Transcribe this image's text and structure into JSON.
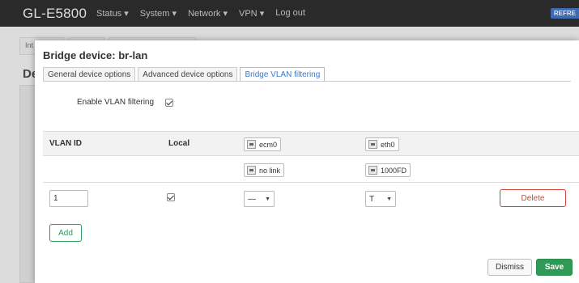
{
  "header": {
    "brand": "GL-E5800",
    "nav": [
      "Status",
      "System",
      "Network",
      "VPN",
      "Log out"
    ],
    "refresh_badge": "REFRE"
  },
  "background": {
    "tabs": [
      "Int",
      "",
      ""
    ],
    "title": "De"
  },
  "modal": {
    "title": "Bridge device: br-lan",
    "tabs": [
      "General device options",
      "Advanced device options",
      "Bridge VLAN filtering"
    ],
    "active_tab": "Bridge VLAN filtering",
    "enable_vlan_label": "Enable VLAN filtering",
    "enable_vlan_checked": true,
    "table": {
      "headers": {
        "vlan_id": "VLAN ID",
        "local": "Local"
      },
      "ports": [
        {
          "name": "ecm0",
          "status": "no link",
          "icon": "network-port-icon"
        },
        {
          "name": "eth0",
          "status": "1000FD",
          "icon": "network-port-icon"
        }
      ],
      "rows": [
        {
          "vlan_id": "1",
          "local_checked": true,
          "port_values": [
            "—",
            "T"
          ],
          "delete_label": "Delete"
        }
      ]
    },
    "add_label": "Add",
    "dismiss_label": "Dismiss",
    "save_label": "Save"
  },
  "colors": {
    "topbar": "#2a2a2a",
    "active_tab": "#3a7ac8",
    "delete": "#d04437",
    "add": "#2a9d5a",
    "save": "#2f9a56"
  }
}
